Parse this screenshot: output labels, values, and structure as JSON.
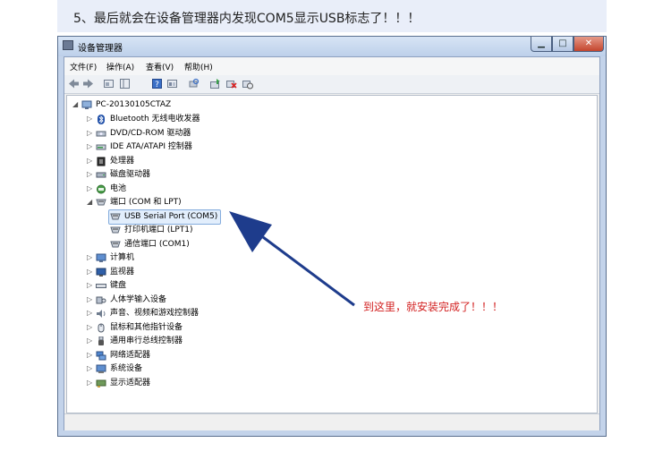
{
  "step_caption": "5、最后就会在设备管理器内发现COM5显示USB标志了！！！",
  "window": {
    "title": "设备管理器",
    "controls": {
      "minimize": "▁",
      "maximize": "□",
      "close": "✕"
    }
  },
  "menu": [
    "文件(F)",
    "操作(A)",
    "查看(V)",
    "帮助(H)"
  ],
  "tree": {
    "root": "PC-20130105CTAZ",
    "categories": [
      "Bluetooth 无线电收发器",
      "DVD/CD-ROM 驱动器",
      "IDE ATA/ATAPI 控制器",
      "处理器",
      "磁盘驱动器",
      "电池",
      "端口 (COM 和 LPT)",
      "计算机",
      "监视器",
      "键盘",
      "人体学输入设备",
      "声音、视频和游戏控制器",
      "鼠标和其他指针设备",
      "通用串行总线控制器",
      "网络适配器",
      "系统设备",
      "显示适配器"
    ],
    "ports_children": [
      "USB Serial Port (COM5)",
      "打印机端口 (LPT1)",
      "通信端口 (COM1)"
    ]
  },
  "annotation": "到这里，就安装完成了！！！",
  "colors": {
    "annotation": "#d21f1f",
    "arrow": "#1e3c8c",
    "banner": "#e9eef9"
  }
}
